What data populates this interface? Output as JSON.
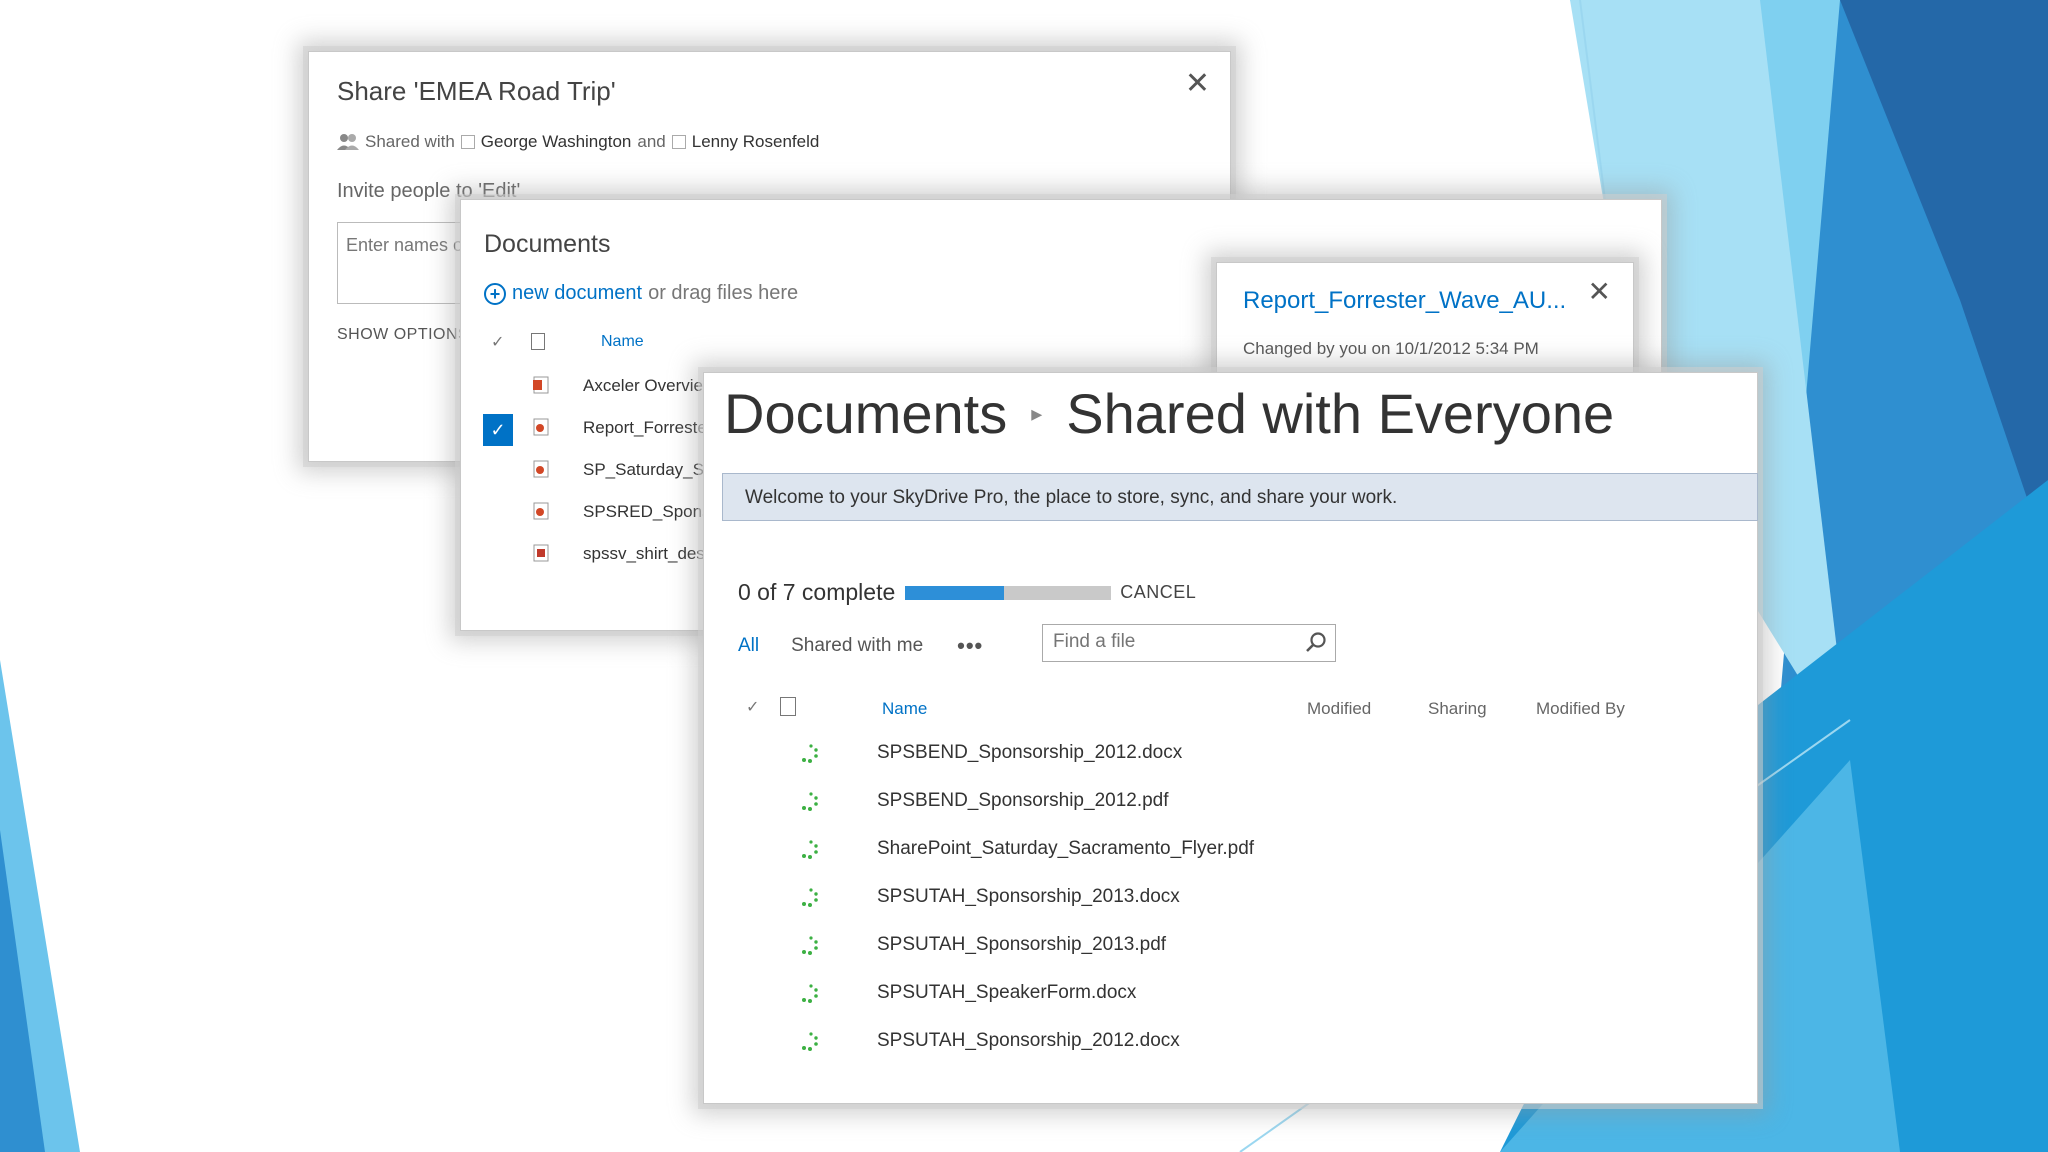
{
  "share_dialog": {
    "title": "Share 'EMEA Road Trip'",
    "shared_with_label": "Shared with",
    "person1": "George Washington",
    "and": "and",
    "person2": "Lenny Rosenfeld",
    "invite_label": "Invite people to 'Edit'",
    "names_placeholder": "Enter names or email addresses...",
    "show_options": "SHOW OPTIONS"
  },
  "documents": {
    "title": "Documents",
    "new_document": "new document",
    "drag_hint": "or drag files here",
    "name_header": "Name",
    "items": [
      {
        "name": "Axceler Overview",
        "selected": false,
        "icon": "powerpoint-file-icon"
      },
      {
        "name": "Report_Forrester_Wave_AU",
        "selected": true,
        "icon": "pdf-file-icon"
      },
      {
        "name": "SP_Saturday_Sacramento",
        "selected": false,
        "icon": "pdf-file-icon"
      },
      {
        "name": "SPSRED_Sponsorship",
        "selected": false,
        "icon": "pdf-file-icon"
      },
      {
        "name": "spssv_shirt_design",
        "selected": false,
        "icon": "image-file-icon"
      }
    ]
  },
  "callout": {
    "title": "Report_Forrester_Wave_AU...",
    "changed": "Changed by you on 10/1/2012 5:34 PM"
  },
  "main": {
    "breadcrumb_root": "Documents",
    "breadcrumb_sep": "▸",
    "breadcrumb_current": "Shared with Everyone",
    "welcome": "Welcome to your SkyDrive Pro, the place to store, sync, and share your work.",
    "progress_text": "0 of 7 complete",
    "progress_fraction": 0.48,
    "cancel": "CANCEL",
    "filter_all": "All",
    "filter_shared": "Shared with me",
    "filter_more": "•••",
    "search_placeholder": "Find a file",
    "col_name": "Name",
    "col_modified": "Modified",
    "col_sharing": "Sharing",
    "col_modified_by": "Modified By",
    "files": [
      "SPSBEND_Sponsorship_2012.docx",
      "SPSBEND_Sponsorship_2012.pdf",
      "SharePoint_Saturday_Sacramento_Flyer.pdf",
      "SPSUTAH_Sponsorship_2013.docx",
      "SPSUTAH_Sponsorship_2013.pdf",
      "SPSUTAH_SpeakerForm.docx",
      "SPSUTAH_Sponsorship_2012.docx"
    ]
  },
  "colors": {
    "accent": "#0072c6",
    "progress": "#2d8fd8",
    "welcome_bg": "#dde5ef",
    "spinner": "#3cb043"
  }
}
